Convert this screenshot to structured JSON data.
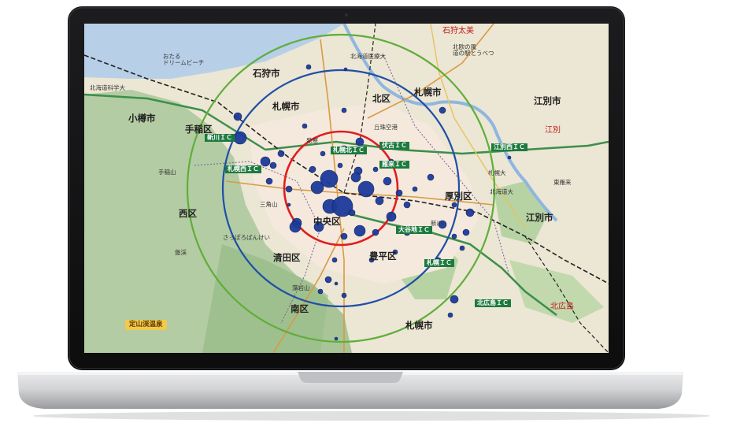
{
  "map": {
    "place_labels": [
      {
        "text": "石狩市",
        "cls": "big"
      },
      {
        "text": "札幌市",
        "cls": "big"
      },
      {
        "text": "北区",
        "cls": "big"
      },
      {
        "text": "札幌市",
        "cls": "big"
      },
      {
        "text": "江別市",
        "cls": "big"
      },
      {
        "text": "小樽市",
        "cls": "big"
      },
      {
        "text": "手稲区",
        "cls": "big"
      },
      {
        "text": "西区",
        "cls": "big"
      },
      {
        "text": "厚別区",
        "cls": "big"
      },
      {
        "text": "江別市",
        "cls": "big"
      },
      {
        "text": "豊平区",
        "cls": "big"
      },
      {
        "text": "南区",
        "cls": "big"
      },
      {
        "text": "札幌市",
        "cls": "big"
      },
      {
        "text": "中央区",
        "cls": "big"
      },
      {
        "text": "清田区",
        "cls": "big"
      },
      {
        "text": "おたる\nドリームビーチ",
        "cls": "small"
      },
      {
        "text": "北海道科学大",
        "cls": "small"
      },
      {
        "text": "北海道医療大",
        "cls": "small"
      },
      {
        "text": "北欧の風\n道の駅とうべつ",
        "cls": "small"
      },
      {
        "text": "丘珠空港",
        "cls": "small"
      },
      {
        "text": "札幌大",
        "cls": "small"
      },
      {
        "text": "北海道大",
        "cls": "small"
      },
      {
        "text": "手稲山",
        "cls": "small"
      },
      {
        "text": "さっぽろばんけい",
        "cls": "small"
      },
      {
        "text": "藻岩山",
        "cls": "small"
      },
      {
        "text": "三角山",
        "cls": "small"
      },
      {
        "text": "盤渓",
        "cls": "small"
      },
      {
        "text": "発寒",
        "cls": "small"
      },
      {
        "text": "新川",
        "cls": "small"
      },
      {
        "text": "東雁来",
        "cls": "small"
      },
      {
        "text": "定山渓温泉",
        "cls": "onsen"
      },
      {
        "text": "札幌北ＩＣ",
        "cls": "ic"
      },
      {
        "text": "伏古ＩＣ",
        "cls": "ic"
      },
      {
        "text": "雁来ＩＣ",
        "cls": "ic"
      },
      {
        "text": "江別西ＩＣ",
        "cls": "ic"
      },
      {
        "text": "新川ＩＣ",
        "cls": "ic"
      },
      {
        "text": "札幌西ＩＣ",
        "cls": "ic"
      },
      {
        "text": "大谷地ＩＣ",
        "cls": "ic"
      },
      {
        "text": "札幌ＩＣ",
        "cls": "ic"
      },
      {
        "text": "北広島ＩＣ",
        "cls": "ic"
      },
      {
        "text": "石狩太美",
        "cls": "red"
      },
      {
        "text": "北広島",
        "cls": "red"
      },
      {
        "text": "江別",
        "cls": "red"
      }
    ],
    "ring_colors": {
      "inner": "#e11d1d",
      "middle": "#1f4fa8",
      "outer": "#5fae3a"
    },
    "marker_color": "#1d3b9a",
    "markers": [
      {
        "r": 11
      },
      {
        "r": 9
      },
      {
        "r": 8
      },
      {
        "r": 13
      },
      {
        "r": 10
      },
      {
        "r": 7
      },
      {
        "r": 6
      },
      {
        "r": 6
      },
      {
        "r": 5
      },
      {
        "r": 5
      },
      {
        "r": 7
      },
      {
        "r": 4
      },
      {
        "r": 4
      },
      {
        "r": 6
      },
      {
        "r": 5
      },
      {
        "r": 4
      },
      {
        "r": 8
      },
      {
        "r": 5
      },
      {
        "r": 4
      },
      {
        "r": 3
      },
      {
        "r": 3
      },
      {
        "r": 5
      },
      {
        "r": 4
      },
      {
        "r": 3
      },
      {
        "r": 6
      },
      {
        "r": 4
      },
      {
        "r": 3
      },
      {
        "r": 4
      },
      {
        "r": 5
      },
      {
        "r": 3
      },
      {
        "r": 4
      },
      {
        "r": 3
      },
      {
        "r": 5
      },
      {
        "r": 3
      },
      {
        "r": 4
      },
      {
        "r": 3
      },
      {
        "r": 4
      },
      {
        "r": 5
      },
      {
        "r": 3
      },
      {
        "r": 4
      },
      {
        "r": 3
      },
      {
        "r": 2
      },
      {
        "r": 4
      },
      {
        "r": 3
      },
      {
        "r": 5
      },
      {
        "r": 3
      },
      {
        "r": 4
      },
      {
        "r": 6
      },
      {
        "r": 3
      },
      {
        "r": 4
      },
      {
        "r": 3
      },
      {
        "r": 2
      },
      {
        "r": 3
      },
      {
        "r": 4
      },
      {
        "r": 3
      },
      {
        "r": 2
      },
      {
        "r": 3
      },
      {
        "r": 2
      },
      {
        "r": 3
      },
      {
        "r": 2
      }
    ]
  }
}
